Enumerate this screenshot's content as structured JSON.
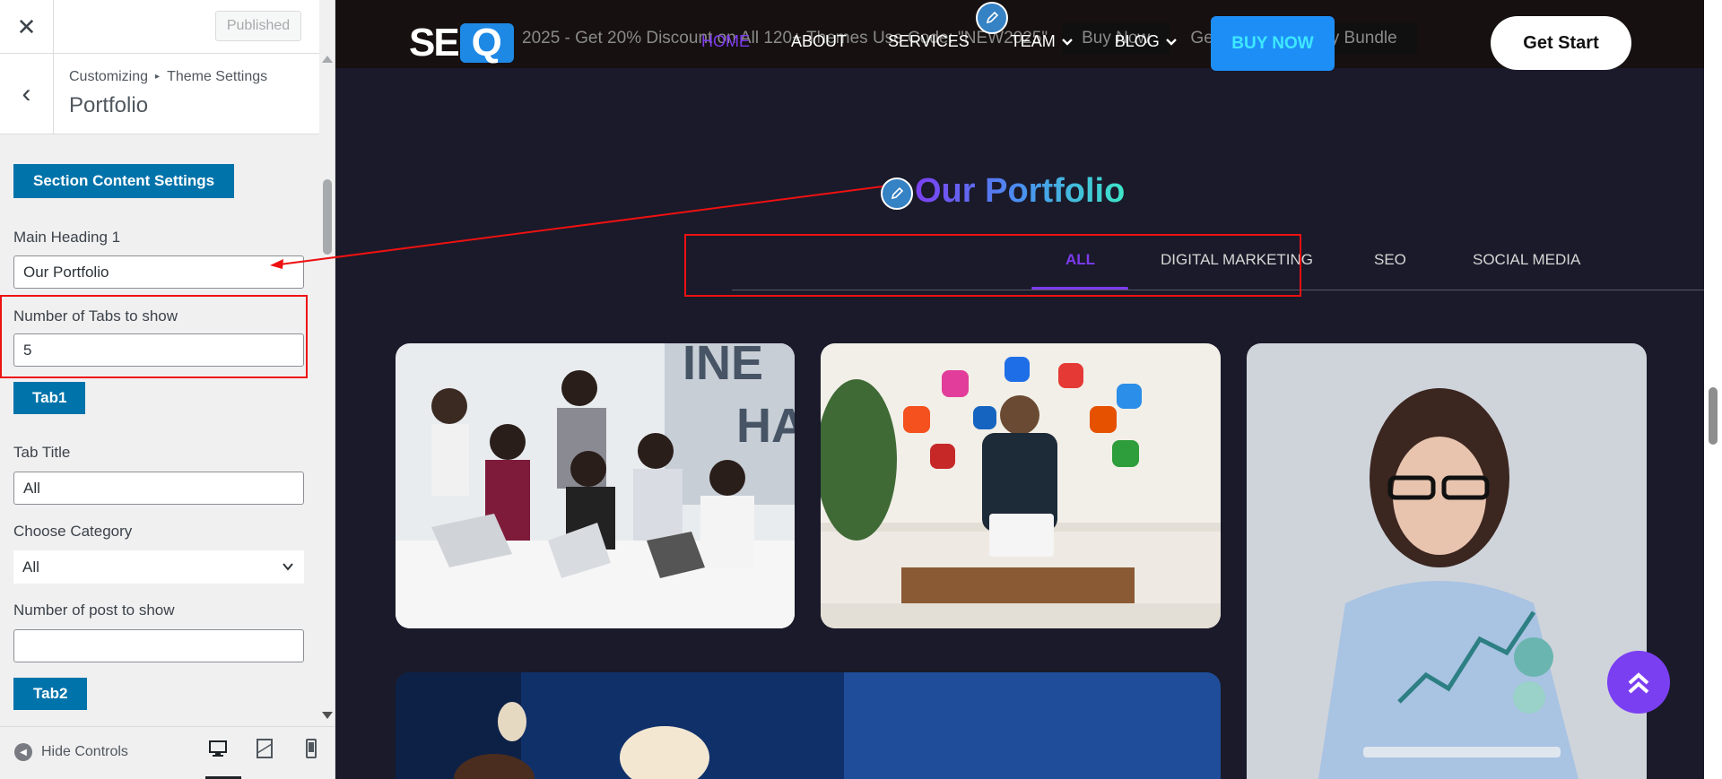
{
  "panel": {
    "published_label": "Published",
    "breadcrumb": {
      "root": "Customizing",
      "separator": "▸",
      "parent": "Theme Settings"
    },
    "section_title": "Portfolio",
    "section_content_btn": "Section Content Settings",
    "main_heading_label": "Main Heading 1",
    "main_heading_value": "Our Portfolio",
    "num_tabs_label": "Number of Tabs to show",
    "num_tabs_value": "5",
    "tab1_btn": "Tab1",
    "tab_title_label": "Tab Title",
    "tab_title_value": "All",
    "category_label": "Choose Category",
    "category_value": "All",
    "num_posts_label": "Number of post to show",
    "num_posts_value": "",
    "tab2_btn": "Tab2",
    "hide_controls_label": "Hide Controls"
  },
  "preview": {
    "promo": {
      "text": "2025 - Get 20% Discount on All 120+ Themes Use Code: \"NEW2025\"",
      "buttons": [
        "Buy Now",
        "Buy Bundle"
      ],
      "middle_text": "Get Bundle"
    },
    "logo": {
      "left": "SE",
      "right": "Q"
    },
    "nav": [
      "HOME",
      "ABOUT",
      "SERVICES",
      "TEAM",
      "BLOG"
    ],
    "buy_now_label": "BUY NOW",
    "get_start_label": "Get Start",
    "heading": "Our Portfolio",
    "tabs": [
      "ALL",
      "DIGITAL MARKETING",
      "SEO",
      "SOCIAL MEDIA"
    ]
  },
  "colors": {
    "accent_purple": "#7c3aed",
    "brand_blue": "#1e8ef7",
    "wp_blue": "#0073aa",
    "annotation_red": "#ee1111"
  }
}
